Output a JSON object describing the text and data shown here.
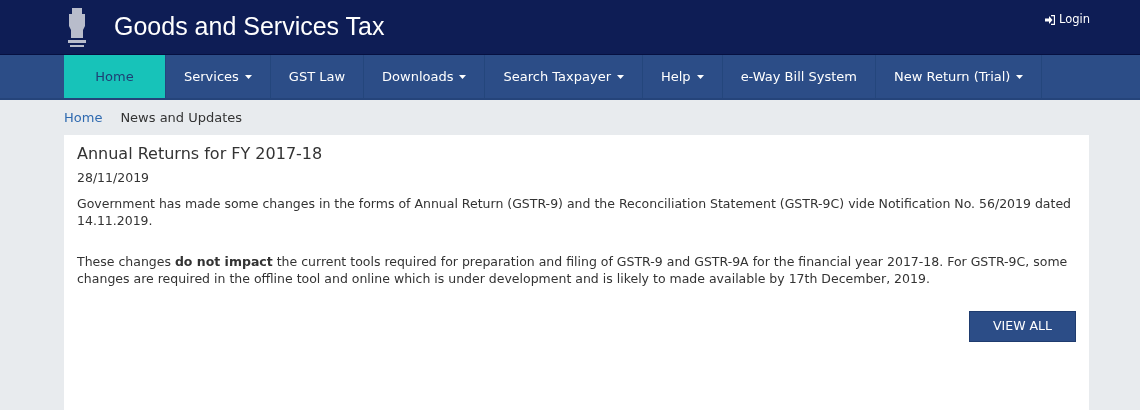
{
  "header": {
    "title": "Goods and Services Tax",
    "login": "Login"
  },
  "nav": [
    {
      "label": "Home",
      "selected": true,
      "has_menu": false
    },
    {
      "label": "Services",
      "selected": false,
      "has_menu": true
    },
    {
      "label": "GST Law",
      "selected": false,
      "has_menu": false
    },
    {
      "label": "Downloads",
      "selected": false,
      "has_menu": true
    },
    {
      "label": "Search Taxpayer",
      "selected": false,
      "has_menu": true
    },
    {
      "label": "Help",
      "selected": false,
      "has_menu": true
    },
    {
      "label": "e-Way Bill System",
      "selected": false,
      "has_menu": false
    },
    {
      "label": "New Return (Trial)",
      "selected": false,
      "has_menu": true
    }
  ],
  "breadcrumb": [
    "Home",
    "News and Updates"
  ],
  "article": {
    "title": "Annual Returns for FY 2017-18",
    "date": "28/11/2019",
    "paragraphs": [
      "Government has made some changes in the forms of Annual Return (GSTR-9) and the Reconciliation Statement (GSTR-9C) vide Notification No. 56/2019 dated 14.11.2019.",
      "These changes **do not impact** the current tools required for preparation and filing of GSTR-9 and GSTR-9A for the financial year 2017-18. For GSTR-9C, some changes are required in the offline tool and online which is under development and is likely to made available by 17th December, 2019."
    ],
    "button": "VIEW ALL"
  }
}
